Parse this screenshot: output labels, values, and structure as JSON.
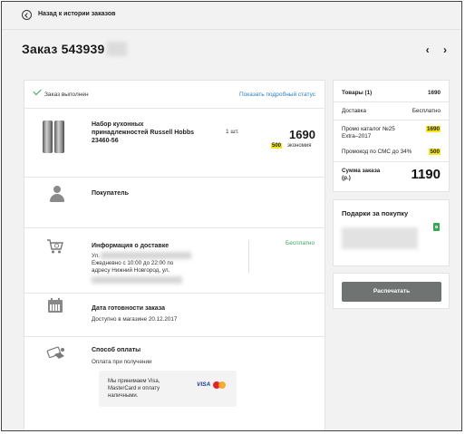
{
  "header": {
    "back_label": "Назад к истории заказов",
    "prev_icon": "chevron-left-icon",
    "next_icon": "chevron-right-icon",
    "prev_glyph": "‹",
    "next_glyph": "›"
  },
  "order": {
    "title": "Заказ 543939"
  },
  "status": {
    "text": "Заказ выполнен",
    "link": "Показать подробный статус"
  },
  "product": {
    "name": "Набор кухонных принадлежностей Russell Hobbs 23460-56",
    "qty": "1 шт.",
    "price": "1690",
    "save_value": "500",
    "save_label": "экономия"
  },
  "buyer": {
    "title": "Покупатель"
  },
  "delivery": {
    "title": "Информация о доставке",
    "line1": "Ул.",
    "line2": "Ежедневно с 10:00 до 22:00 по",
    "line3": "адресу Нижний Новгород, ул.",
    "price": "Бесплатно"
  },
  "readiness": {
    "title": "Дата готовности заказа",
    "text": "Доступно в магазине 20.12.2017"
  },
  "payment": {
    "title": "Способ оплаты",
    "method": "Оплата при получении",
    "accept_text": "Мы принимаем Visa, MasterCard и оплату наличными.",
    "visa": "VISA"
  },
  "summary": {
    "items_label": "Товары (1)",
    "items_value": "1690",
    "delivery_label": "Доставка",
    "delivery_value": "Бесплатно",
    "promo1_label": "Промо каталог №25 Extra–2017",
    "promo1_value": "1690",
    "promo2_label": "Промокод по СМС до 34%",
    "promo2_value": "500",
    "total_label": "Сумма заказа (р.)",
    "total_value": "1190"
  },
  "gifts": {
    "title": "Подарки за покупку"
  },
  "actions": {
    "print_label": "Распечатать"
  },
  "colors": {
    "accent_green": "#3aa55c",
    "link_blue": "#2a7fc6",
    "highlight_yellow": "#f4e51c",
    "button_gray": "#6f7472"
  }
}
